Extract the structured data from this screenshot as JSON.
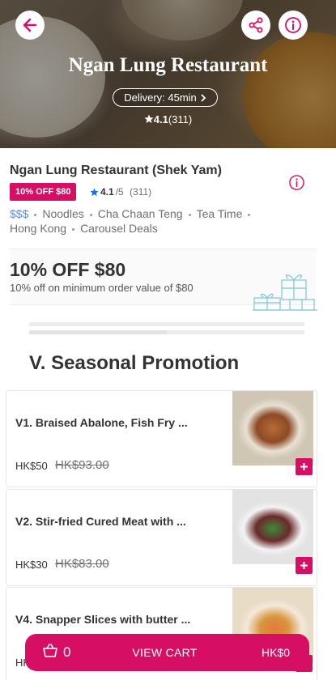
{
  "hero": {
    "title": "Ngan Lung Restaurant",
    "delivery": "Delivery: 45min",
    "rating": "4.1",
    "rating_count": "(311)"
  },
  "restaurant": {
    "name": "Ngan Lung Restaurant (Shek Yam)",
    "discount_badge": "10% OFF $80",
    "rating": "4.1",
    "rating_scale": "/5",
    "rating_count": "(311)",
    "price_level": "$$$",
    "tags_line1": [
      "Noodles",
      "Cha Chaan Teng",
      "Tea Time"
    ],
    "tags_line2": [
      "Hong Kong",
      "Carousel Deals"
    ]
  },
  "promo": {
    "title": "10% OFF $80",
    "subtitle": "10% off on minimum order value of $80"
  },
  "section": {
    "title": "V. Seasonal Promotion"
  },
  "menu_items": [
    {
      "name": "V1. Braised Abalone, Fish Fry ...",
      "price": "HK$50",
      "old_price": "HK$93.00"
    },
    {
      "name": "V2. Stir-fried Cured Meat with ...",
      "price": "HK$30",
      "old_price": "HK$83.00"
    },
    {
      "name": "V4. Snapper Slices with butter ...",
      "price": "HK$",
      "old_price": ""
    }
  ],
  "cart": {
    "count": "0",
    "label": "VIEW CART",
    "total": "HK$0"
  },
  "colors": {
    "brand": "#d70f64",
    "price_level": "#5b8ae6"
  },
  "icons": {
    "back": "arrow-left-icon",
    "share": "share-icon",
    "info": "info-icon",
    "star": "star-icon",
    "basket": "basket-icon",
    "add": "plus-icon"
  }
}
